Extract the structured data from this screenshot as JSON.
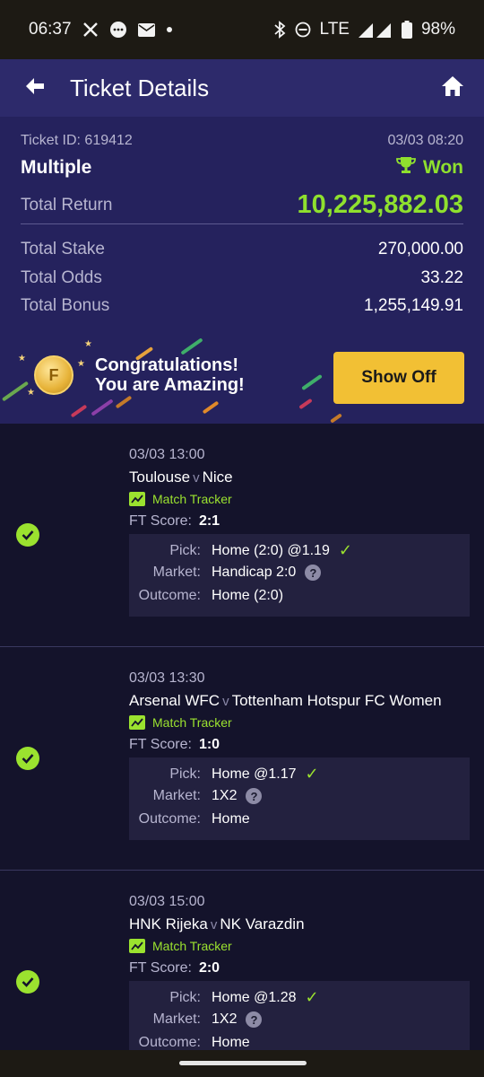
{
  "status": {
    "time": "06:37",
    "network": "LTE",
    "battery": "98%",
    "icons": [
      "x-icon",
      "chat-icon",
      "mail-icon",
      "dot-icon",
      "bluetooth-icon",
      "dnd-icon",
      "signal-icon",
      "battery-icon"
    ]
  },
  "header": {
    "title": "Ticket Details",
    "back_icon": "back-arrow-icon",
    "home_icon": "home-icon"
  },
  "ticket": {
    "id_label": "Ticket ID: 619412",
    "datetime": "03/03 08:20",
    "type": "Multiple",
    "status": "Won",
    "total_return_label": "Total Return",
    "total_return": "10,225,882.03",
    "total_stake_label": "Total Stake",
    "total_stake": "270,000.00",
    "total_odds_label": "Total Odds",
    "total_odds": "33.22",
    "total_bonus_label": "Total Bonus",
    "total_bonus": "1,255,149.91"
  },
  "banner": {
    "line1": "Congratulations!",
    "line2": "You are Amazing!",
    "button": "Show Off",
    "coin_letter": "F"
  },
  "colors": {
    "accent_green": "#8fe02e",
    "button_yellow": "#f2c034",
    "header_bg": "#2d2a6b"
  },
  "bets": [
    {
      "time": "03/03 13:00",
      "home": "Toulouse",
      "sep": "v",
      "away": "Nice",
      "tracker": "Match Tracker",
      "score_label": "FT Score:",
      "score": "2:1",
      "pick_label": "Pick:",
      "pick": "Home (2:0) @1.19",
      "market_label": "Market:",
      "market": "Handicap 2:0",
      "outcome_label": "Outcome:",
      "outcome": "Home (2:0)"
    },
    {
      "time": "03/03 13:30",
      "home": "Arsenal WFC",
      "sep": "v",
      "away": "Tottenham Hotspur FC Women",
      "tracker": "Match Tracker",
      "score_label": "FT Score:",
      "score": "1:0",
      "pick_label": "Pick:",
      "pick": "Home @1.17",
      "market_label": "Market:",
      "market": "1X2",
      "outcome_label": "Outcome:",
      "outcome": "Home"
    },
    {
      "time": "03/03 15:00",
      "home": "HNK Rijeka",
      "sep": "v",
      "away": "NK Varazdin",
      "tracker": "Match Tracker",
      "score_label": "FT Score:",
      "score": "2:0",
      "pick_label": "Pick:",
      "pick": "Home @1.28",
      "market_label": "Market:",
      "market": "1X2",
      "outcome_label": "Outcome:",
      "outcome": "Home"
    }
  ]
}
